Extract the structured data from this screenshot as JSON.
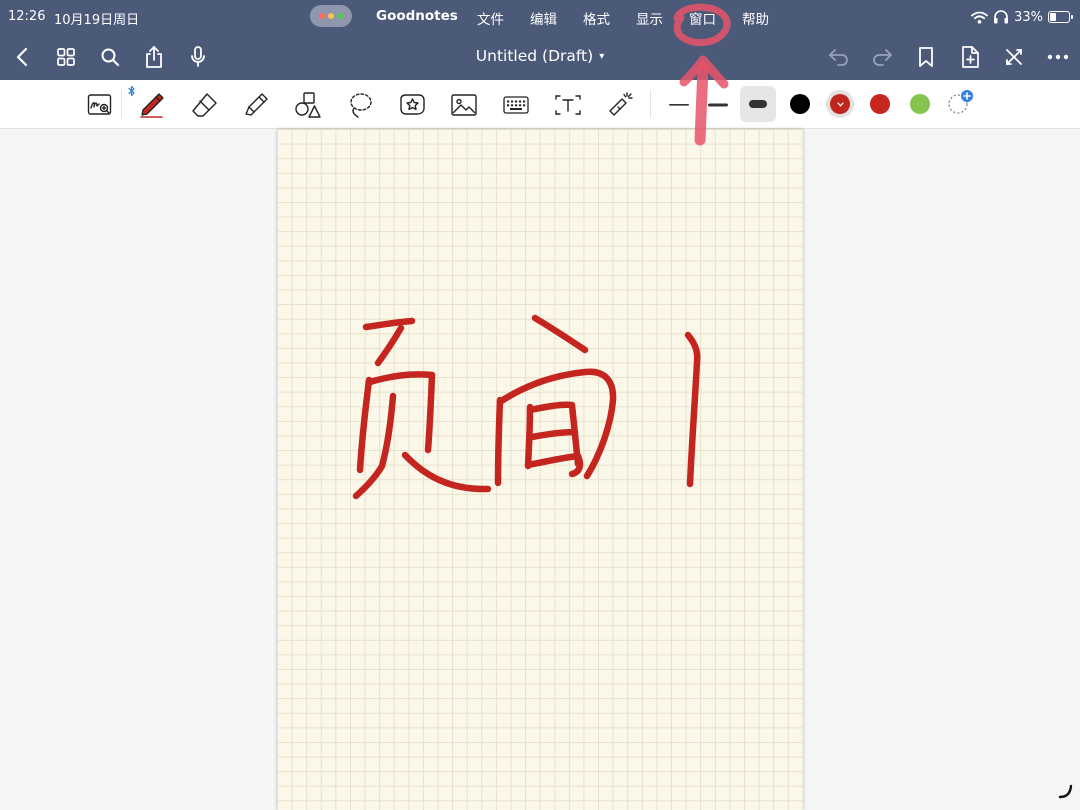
{
  "status_bar": {
    "time": "12:26",
    "date": "10月19日周日",
    "battery_percent": "33%",
    "battery_level": 0.33,
    "icons": [
      "wifi-icon",
      "headphones-icon",
      "battery-icon"
    ]
  },
  "menu": {
    "app_name": "Goodnotes",
    "items": [
      "文件",
      "编辑",
      "格式",
      "显示",
      "窗口",
      "帮助"
    ]
  },
  "navbar": {
    "title": "Untitled (Draft)",
    "left_icons": [
      "back-icon",
      "grid-icon",
      "search-icon",
      "share-icon",
      "microphone-icon"
    ],
    "right_icons": [
      "undo-icon",
      "redo-icon",
      "bookmark-icon",
      "add-page-icon",
      "close-icon",
      "more-icon"
    ]
  },
  "toolbar": {
    "tools": [
      "handwriting-zoom-icon",
      "pen-icon",
      "eraser-icon",
      "highlighter-icon",
      "shapes-icon",
      "lasso-icon",
      "sticker-icon",
      "image-icon",
      "keyboard-icon",
      "text-icon",
      "laser-pointer-icon"
    ],
    "stroke_widths": [
      "thin",
      "medium",
      "thick"
    ],
    "selected_stroke": "thick",
    "colors": [
      "#000000",
      "#c0261e",
      "#c7271f",
      "#86c450"
    ],
    "selected_color": "#c0261e",
    "add_color_icon": "add-color-icon"
  },
  "page": {
    "paper_color": "#fbf8ea",
    "grid_color": "#e6e1c8",
    "ink_color": "#c4261f",
    "annotation_color": "#e8546a"
  }
}
